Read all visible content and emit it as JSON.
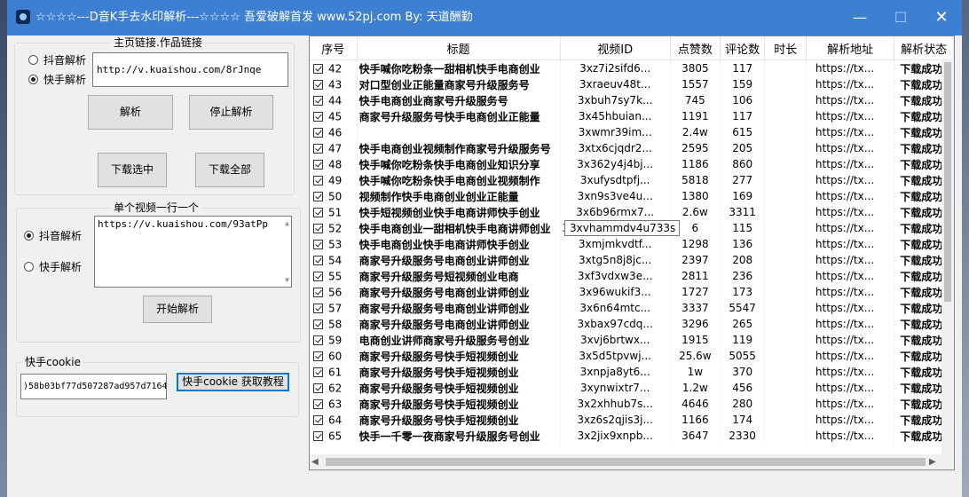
{
  "window": {
    "title": "☆☆☆☆---D音K手去水印解析---☆☆☆☆  吾爱破解首发  www.52pj.com   By:  天道酬勤",
    "minimize": "—",
    "maximize": "☐",
    "close": "✕"
  },
  "homepage": {
    "legend": "主页链接.作品链接",
    "radio_douyin": "抖音解析",
    "radio_kuaishou": "快手解析",
    "url": "http://v.kuaishou.com/8rJnqe",
    "parse_button": "解析",
    "stop_button": "停止解析",
    "download_selected": "下载选中",
    "download_all": "下载全部"
  },
  "single": {
    "legend": "单个视频一行一个",
    "radio_douyin": "抖音解析",
    "radio_kuaishou": "快手解析",
    "text": "https://v.kuaishou.com/93atPp",
    "start_button": "开始解析"
  },
  "cookie": {
    "legend": "快手cookie",
    "value": ")58b03bf77d507287ad957d7164",
    "tutorial_button": "快手cookie 获取教程"
  },
  "table": {
    "columns": [
      "序号",
      "标题",
      "视频ID",
      "点赞数",
      "评论数",
      "时长",
      "解析地址",
      "解析状态"
    ],
    "rows": [
      [
        "42",
        "快手喊你吃粉条一甜相机快手电商创业",
        "3xz7i2sifd6...",
        "3805",
        "117",
        "",
        "https://tx...",
        "下载成功"
      ],
      [
        "43",
        "对口型创业正能量商家号升级服务号",
        "3xraeuv48t...",
        "1557",
        "159",
        "",
        "https://tx...",
        "下载成功"
      ],
      [
        "44",
        "快手电商创业商家号升级服务号",
        "3xbuh7sy7k...",
        "745",
        "106",
        "",
        "https://tx...",
        "下载成功"
      ],
      [
        "45",
        "商家号升级服务号快手电商创业正能量",
        "3x45hbuian...",
        "1191",
        "117",
        "",
        "https://tx...",
        "下载成功"
      ],
      [
        "46",
        "",
        "3xwmr39im...",
        "2.4w",
        "615",
        "",
        "https://tx...",
        "下载成功"
      ],
      [
        "47",
        "快手电商创业视频制作商家号升级服务号",
        "3xtx6cjqdr2...",
        "2595",
        "205",
        "",
        "https://tx...",
        "下载成功"
      ],
      [
        "48",
        "快手喊你吃粉条快手电商创业知识分享",
        "3x362y4j4bj...",
        "1186",
        "860",
        "",
        "https://tx...",
        "下载成功"
      ],
      [
        "49",
        "快手喊你吃粉条快手电商创业视频制作",
        "3xufysdtpfj...",
        "5818",
        "277",
        "",
        "https://tx...",
        "下载成功"
      ],
      [
        "50",
        "视频制作快手电商创业创业正能量",
        "3xn9s3ve4u...",
        "1380",
        "169",
        "",
        "https://tx...",
        "下载成功"
      ],
      [
        "51",
        "快手短视频创业快手电商讲师快手创业",
        "3x6b96rmx7...",
        "2.6w",
        "3311",
        "",
        "https://tx...",
        "下载成功"
      ],
      [
        "52",
        "快手电商创业一甜相机快手电商讲师创业",
        "3xvhammdv4u733s",
        "6",
        "115",
        "",
        "https://tx...",
        "下载成功"
      ],
      [
        "53",
        "快手电商创业快手电商讲师快手创业",
        "3xmjmkvdtf...",
        "1298",
        "136",
        "",
        "https://tx...",
        "下载成功"
      ],
      [
        "54",
        "商家号升级服务号电商创业讲师创业",
        "3xtg5n8j8jc...",
        "2397",
        "208",
        "",
        "https://tx...",
        "下载成功"
      ],
      [
        "55",
        "商家号升级服务号短视频创业电商",
        "3xf3vdxw3e...",
        "2811",
        "236",
        "",
        "https://tx...",
        "下载成功"
      ],
      [
        "56",
        "商家号升级服务号电商创业讲师创业",
        "3x96wukif3...",
        "1727",
        "173",
        "",
        "https://tx...",
        "下载成功"
      ],
      [
        "57",
        "商家号升级服务号电商创业讲师创业",
        "3x6n64mtc...",
        "3337",
        "5547",
        "",
        "https://tx...",
        "下载成功"
      ],
      [
        "58",
        "商家号升级服务号电商创业讲师创业",
        "3xbax97cdq...",
        "3296",
        "265",
        "",
        "https://tx...",
        "下载成功"
      ],
      [
        "59",
        "电商创业讲师商家号升级服务号创业",
        "3xvj6brtwx...",
        "1915",
        "119",
        "",
        "https://tx...",
        "下载成功"
      ],
      [
        "60",
        "商家号升级服务号快手短视频创业",
        "3x5d5tpvwj...",
        "25.6w",
        "5055",
        "",
        "https://tx...",
        "下载成功"
      ],
      [
        "61",
        "商家号升级服务号快手短视频创业",
        "3xnpja8yt6...",
        "1w",
        "370",
        "",
        "https://tx...",
        "下载成功"
      ],
      [
        "62",
        "商家号升级服务号快手短视频创业",
        "3xynwixtr7...",
        "1.2w",
        "456",
        "",
        "https://tx...",
        "下载成功"
      ],
      [
        "63",
        "商家号升级服务号快手短视频创业",
        "3x2xhhub7s...",
        "4646",
        "280",
        "",
        "https://tx...",
        "下载成功"
      ],
      [
        "64",
        "商家号升级服务号快手短视频创业",
        "3xz6s2qjis3j...",
        "1166",
        "174",
        "",
        "https://tx...",
        "下载成功"
      ],
      [
        "65",
        "快手一千零一夜商家号升级服务号创业",
        "3x2jix9xnpb...",
        "3647",
        "2330",
        "",
        "https://tx...",
        "下载成功"
      ]
    ],
    "tooltip": "3xvhammdv4u733s"
  },
  "scrollbar": {
    "left_arrow": "◀",
    "right_arrow": "▶"
  },
  "colors": {
    "titlebar": "#3d7fd2",
    "window_bg": "#f0f0f0",
    "button_bg": "#e1e1e1",
    "default_button_border": "#0078d7"
  }
}
